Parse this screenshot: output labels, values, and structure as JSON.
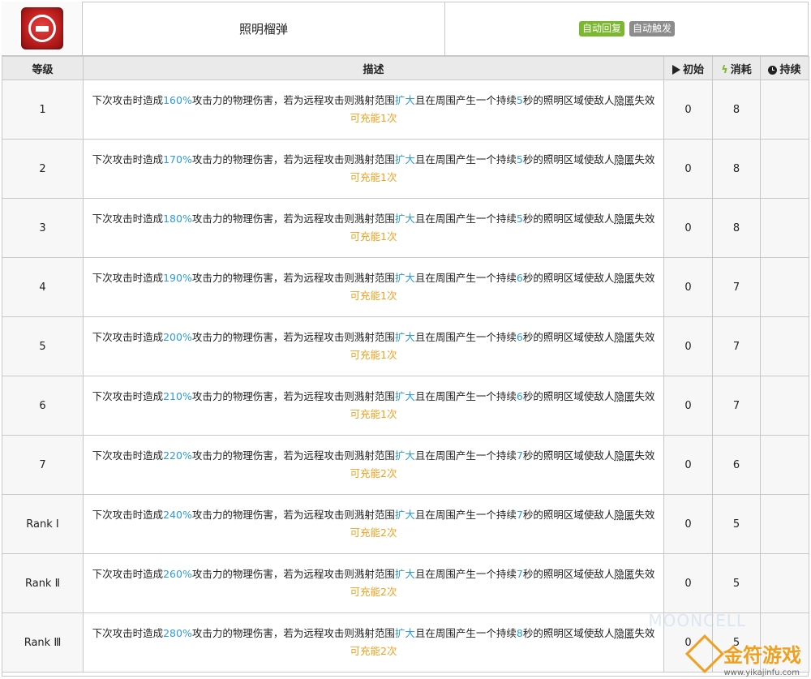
{
  "header": {
    "skill_name": "照明榴弹",
    "tags": [
      "自动回复",
      "自动触发"
    ]
  },
  "columns": {
    "level": "等级",
    "description": "描述",
    "initial": "初始",
    "cost": "消耗",
    "duration": "持续"
  },
  "rows": [
    {
      "level": "1",
      "pct": "160%",
      "sec": "5",
      "charge": "可充能1次",
      "initial": "0",
      "cost": "8",
      "duration": ""
    },
    {
      "level": "2",
      "pct": "170%",
      "sec": "5",
      "charge": "可充能1次",
      "initial": "0",
      "cost": "8",
      "duration": ""
    },
    {
      "level": "3",
      "pct": "180%",
      "sec": "5",
      "charge": "可充能1次",
      "initial": "0",
      "cost": "8",
      "duration": ""
    },
    {
      "level": "4",
      "pct": "190%",
      "sec": "6",
      "charge": "可充能1次",
      "initial": "0",
      "cost": "7",
      "duration": ""
    },
    {
      "level": "5",
      "pct": "200%",
      "sec": "6",
      "charge": "可充能1次",
      "initial": "0",
      "cost": "7",
      "duration": ""
    },
    {
      "level": "6",
      "pct": "210%",
      "sec": "6",
      "charge": "可充能1次",
      "initial": "0",
      "cost": "7",
      "duration": ""
    },
    {
      "level": "7",
      "pct": "220%",
      "sec": "7",
      "charge": "可充能2次",
      "initial": "0",
      "cost": "6",
      "duration": ""
    },
    {
      "level": "Rank Ⅰ",
      "pct": "240%",
      "sec": "7",
      "charge": "可充能2次",
      "initial": "0",
      "cost": "5",
      "duration": ""
    },
    {
      "level": "Rank Ⅱ",
      "pct": "260%",
      "sec": "7",
      "charge": "可充能2次",
      "initial": "0",
      "cost": "5",
      "duration": ""
    },
    {
      "level": "Rank Ⅲ",
      "pct": "280%",
      "sec": "8",
      "charge": "可充能2次",
      "initial": "0",
      "cost": "5",
      "duration": ""
    }
  ],
  "desc_parts": {
    "p1": "下次攻击时造成",
    "p2": "攻击力的物理伤害，若为远程攻击则溅射范围",
    "expand": "扩大",
    "p3": "且在周围产生一个持续",
    "p4": "秒的照明区域使敌人",
    "hidden": "隐匿",
    "p5": "失效"
  },
  "watermark": {
    "brand": "金符游戏",
    "url": "www.yikajinfu.com",
    "faint": "MOONCELL"
  },
  "colors": {
    "highlight": "#2f9bd8",
    "charge": "#f0a020",
    "tag_green": "#7cb82f",
    "tag_gray": "#8c8c8c"
  },
  "icons": {
    "skill": "flare-grenade-skill-icon",
    "initial": "play-triangle-icon",
    "cost": "lightning-bolt-icon",
    "duration": "clock-icon"
  }
}
